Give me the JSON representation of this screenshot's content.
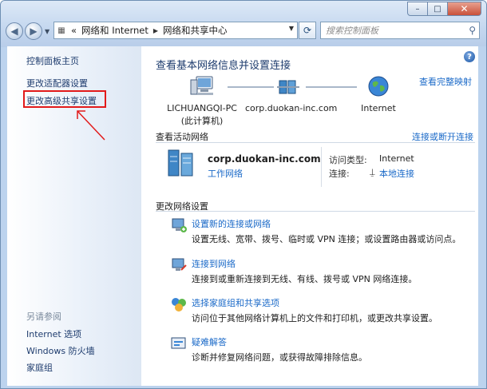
{
  "titlebar": {
    "controls": {
      "minimize": "–",
      "maximize": "□",
      "close": "✕"
    }
  },
  "nav": {
    "back_icon": "back-arrow-icon",
    "forward_icon": "forward-arrow-icon"
  },
  "address": {
    "prefix": "«",
    "segments": [
      "网络和 Internet",
      "网络和共享中心"
    ]
  },
  "search": {
    "placeholder": "搜索控制面板"
  },
  "sidebar": {
    "links": [
      "控制面板主页",
      "更改适配器设置",
      "更改高级共享设置"
    ],
    "see_also_title": "另请参阅",
    "see_also": [
      "Internet 选项",
      "Windows 防火墙",
      "家庭组"
    ]
  },
  "main": {
    "title": "查看基本网络信息并设置连接",
    "full_map_link": "查看完整映射",
    "map_nodes": [
      {
        "label": "LICHUANGQI-PC",
        "sub": "(此计算机)"
      },
      {
        "label": "corp.duokan-inc.com",
        "sub": ""
      },
      {
        "label": "Internet",
        "sub": ""
      }
    ],
    "active_header": "查看活动网络",
    "connect_link": "连接或断开连接",
    "network": {
      "name": "corp.duokan-inc.com",
      "type": "工作网络",
      "access_label": "访问类型:",
      "access_value": "Internet",
      "conn_label": "连接:",
      "conn_value": "本地连接"
    },
    "settings_header": "更改网络设置",
    "tasks": [
      {
        "title": "设置新的连接或网络",
        "desc": "设置无线、宽带、拨号、临时或 VPN 连接；或设置路由器或访问点。"
      },
      {
        "title": "连接到网络",
        "desc": "连接到或重新连接到无线、有线、拨号或 VPN 网络连接。"
      },
      {
        "title": "选择家庭组和共享选项",
        "desc": "访问位于其他网络计算机上的文件和打印机，或更改共享设置。"
      },
      {
        "title": "疑难解答",
        "desc": "诊断并修复网络问题，或获得故障排除信息。"
      }
    ]
  },
  "colors": {
    "link": "#1b6ac8",
    "highlight": "#e21a1a",
    "frame": "#bcd3ee"
  }
}
